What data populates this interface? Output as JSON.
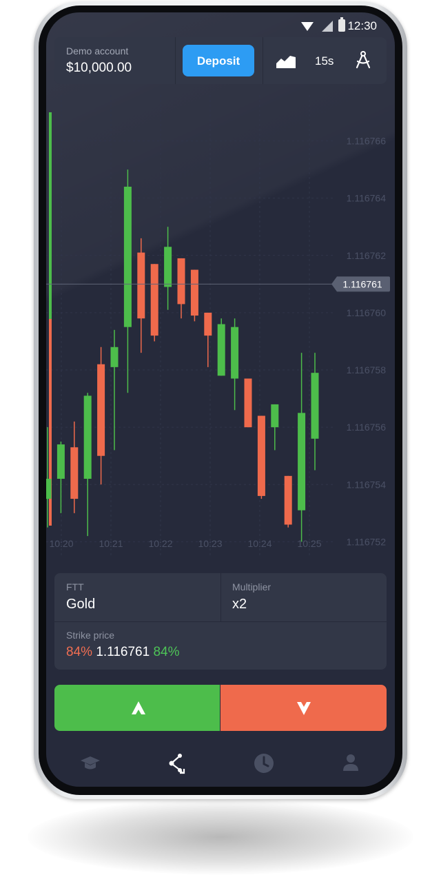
{
  "status_bar": {
    "time": "12:30"
  },
  "account": {
    "label": "Demo account",
    "balance": "$10,000.00",
    "deposit_label": "Deposit"
  },
  "toolbar": {
    "chart_type_icon": "area-chart-icon",
    "timeframe": "15s",
    "tools_icon": "compass-drawing-icon"
  },
  "chart_data": {
    "type": "candlestick",
    "x_labels": [
      "10:20",
      "10:21",
      "10:22",
      "10:23",
      "10:24",
      "10:25"
    ],
    "y_labels": [
      "1.116766",
      "1.116764",
      "1.116762",
      "1.116760",
      "1.116758",
      "1.116756",
      "1.116754",
      "1.116752"
    ],
    "ylim": [
      1.116751,
      1.1167676
    ],
    "current_price": "1.116761",
    "up_color": "#4dbd4b",
    "down_color": "#ef6a4c",
    "candles": [
      {
        "t": 0,
        "open": 1.1167535,
        "high": 1.116756,
        "low": 1.1167525,
        "close": 1.1167542
      },
      {
        "t": 1,
        "open": 1.1167542,
        "high": 1.1167555,
        "low": 1.116753,
        "close": 1.1167554
      },
      {
        "t": 2,
        "open": 1.1167553,
        "high": 1.1167562,
        "low": 1.116753,
        "close": 1.1167535
      },
      {
        "t": 3,
        "open": 1.1167542,
        "high": 1.1167572,
        "low": 1.1167522,
        "close": 1.1167571
      },
      {
        "t": 4,
        "open": 1.1167582,
        "high": 1.1167588,
        "low": 1.116754,
        "close": 1.116755
      },
      {
        "t": 5,
        "open": 1.1167581,
        "high": 1.1167594,
        "low": 1.1167552,
        "close": 1.1167588
      },
      {
        "t": 6,
        "open": 1.1167595,
        "high": 1.116765,
        "low": 1.1167572,
        "close": 1.1167644
      },
      {
        "t": 7,
        "open": 1.1167621,
        "high": 1.1167626,
        "low": 1.1167586,
        "close": 1.1167598
      },
      {
        "t": 8,
        "open": 1.1167617,
        "high": 1.1167617,
        "low": 1.116759,
        "close": 1.1167592
      },
      {
        "t": 9,
        "open": 1.1167609,
        "high": 1.116763,
        "low": 1.1167601,
        "close": 1.1167623
      },
      {
        "t": 10,
        "open": 1.1167619,
        "high": 1.1167619,
        "low": 1.1167598,
        "close": 1.1167603
      },
      {
        "t": 11,
        "open": 1.1167615,
        "high": 1.1167615,
        "low": 1.1167597,
        "close": 1.1167599
      },
      {
        "t": 12,
        "open": 1.11676,
        "high": 1.11676,
        "low": 1.1167581,
        "close": 1.1167592
      },
      {
        "t": 13,
        "open": 1.1167578,
        "high": 1.1167598,
        "low": 1.1167578,
        "close": 1.1167596
      },
      {
        "t": 14,
        "open": 1.1167577,
        "high": 1.1167598,
        "low": 1.1167566,
        "close": 1.1167595
      },
      {
        "t": 15,
        "open": 1.1167577,
        "high": 1.1167577,
        "low": 1.116756,
        "close": 1.116756
      },
      {
        "t": 16,
        "open": 1.1167564,
        "high": 1.1167564,
        "low": 1.1167535,
        "close": 1.1167536
      },
      {
        "t": 17,
        "open": 1.116756,
        "high": 1.1167568,
        "low": 1.1167552,
        "close": 1.1167568
      },
      {
        "t": 18,
        "open": 1.1167543,
        "high": 1.1167543,
        "low": 1.1167525,
        "close": 1.1167526
      },
      {
        "t": 19,
        "open": 1.1167531,
        "high": 1.1167586,
        "low": 1.116752,
        "close": 1.1167565
      },
      {
        "t": 20,
        "open": 1.1167556,
        "high": 1.1167586,
        "low": 1.1167545,
        "close": 1.1167579
      }
    ]
  },
  "trade_form": {
    "ftt_label": "FTT",
    "ftt_value": "Gold",
    "multiplier_label": "Multiplier",
    "multiplier_value": "x2",
    "strike_label": "Strike price",
    "payout_up": "84%",
    "strike_value": "1.116761",
    "payout_down": "84%"
  },
  "actions": {
    "up_icon": "arrow-up-icon",
    "down_icon": "arrow-down-icon"
  },
  "bottom_nav": [
    "education-icon",
    "trade-icon",
    "history-icon",
    "profile-icon"
  ]
}
